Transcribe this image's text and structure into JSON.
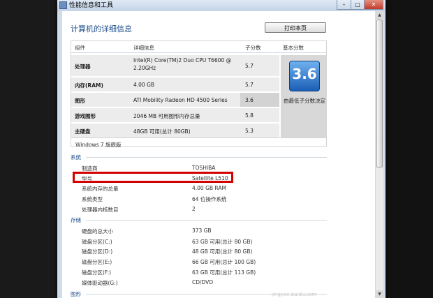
{
  "window": {
    "title": "性能信息和工具",
    "buttons": {
      "minimize": "–",
      "maximize": "□",
      "close": "✕"
    }
  },
  "page": {
    "title": "计算机的详细信息",
    "print_button": "打印本页"
  },
  "table": {
    "headers": [
      "组件",
      "详细信息",
      "子分数",
      "基本分数"
    ],
    "rows": [
      {
        "component": "处理器",
        "detail_line1": "Intel(R) Core(TM)2 Duo CPU T6600 @",
        "detail_line2": "2.20GHz",
        "subscore": "5.7"
      },
      {
        "component": "内存(RAM)",
        "detail_line1": "4.00 GB",
        "subscore": "5.7"
      },
      {
        "component": "图形",
        "detail_line1": "ATI Mobility Radeon HD 4500 Series",
        "subscore": "3.6"
      },
      {
        "component": "游戏图形",
        "detail_line1": "2046 MB 可用图形内存总量",
        "subscore": "5.8"
      },
      {
        "component": "主硬盘",
        "detail_line1": "48GB 可用(总计 80GB)",
        "subscore": "5.3"
      }
    ],
    "base_score": "3.6",
    "base_score_note": "由最低子分数决定",
    "edition": "Windows 7 旗舰版"
  },
  "system": {
    "heading": "系统",
    "items": [
      {
        "label": "制造商",
        "value": "TOSHIBA"
      },
      {
        "label": "型号",
        "value": "Satellite L510"
      },
      {
        "label": "系统内存的总量",
        "value": "4.00 GB RAM"
      },
      {
        "label": "系统类型",
        "value": "64 位操作系统"
      },
      {
        "label": "处理器内核数目",
        "value": "2"
      }
    ]
  },
  "storage": {
    "heading": "存储",
    "items": [
      {
        "label": "硬盘的总大小",
        "value": "373 GB"
      },
      {
        "label": "磁盘分区(C:)",
        "value": "63 GB 可用(总计 80 GB)"
      },
      {
        "label": "磁盘分区(D:)",
        "value": "48 GB 可用(总计 80 GB)"
      },
      {
        "label": "磁盘分区(E:)",
        "value": "66 GB 可用(总计 100 GB)"
      },
      {
        "label": "磁盘分区(F:)",
        "value": "63 GB 可用(总计 113 GB)"
      },
      {
        "label": "媒体驱动器(G:)",
        "value": "CD/DVD"
      }
    ]
  },
  "graphics": {
    "heading": "图形"
  },
  "watermark": "jingyan.baidu.com",
  "colors": {
    "accent": "#1e4e8c",
    "highlight": "#d40000",
    "score_tile": "#1b5fb6"
  }
}
